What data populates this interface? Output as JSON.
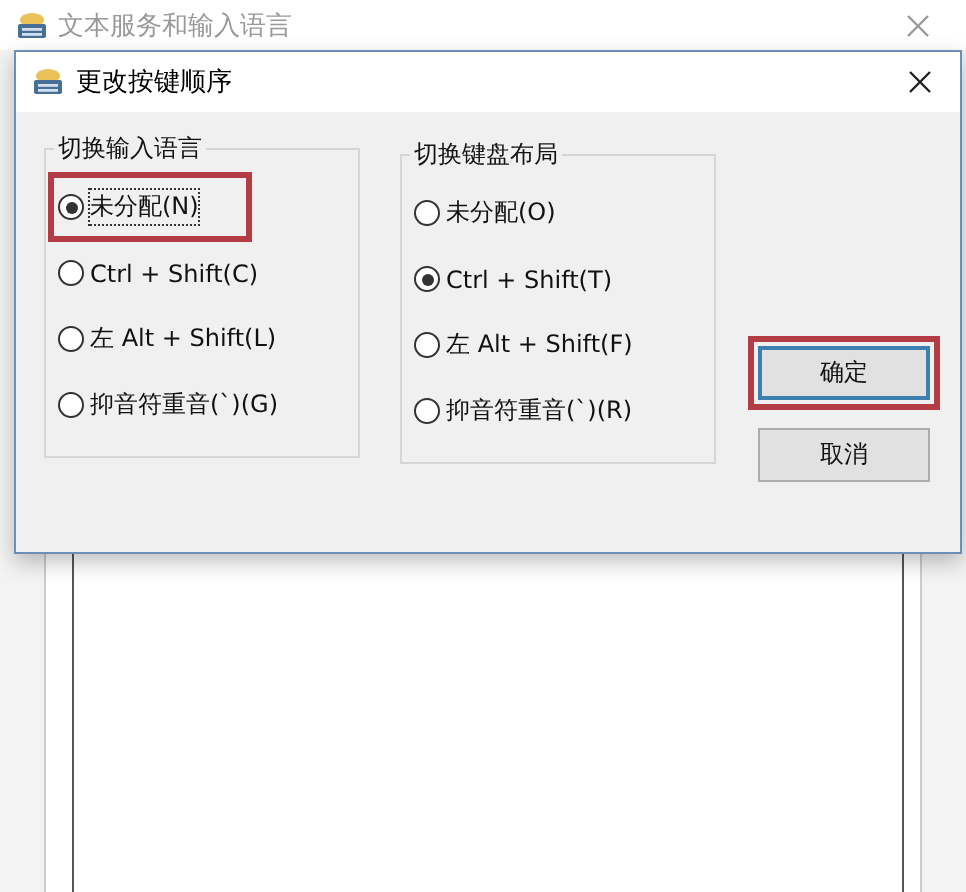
{
  "back_window": {
    "title": "文本服务和输入语言"
  },
  "dialog": {
    "title": "更改按键顺序",
    "groups": [
      {
        "title": "切换输入语言",
        "options": [
          {
            "label": "未分配(N)",
            "selected": true,
            "focused": true,
            "highlighted": true
          },
          {
            "label": "Ctrl + Shift(C)",
            "selected": false,
            "focused": false,
            "highlighted": false
          },
          {
            "label": "左 Alt + Shift(L)",
            "selected": false,
            "focused": false,
            "highlighted": false
          },
          {
            "label": "抑音符重音(`)(G)",
            "selected": false,
            "focused": false,
            "highlighted": false
          }
        ]
      },
      {
        "title": "切换键盘布局",
        "options": [
          {
            "label": "未分配(O)",
            "selected": false,
            "focused": false,
            "highlighted": false
          },
          {
            "label": "Ctrl + Shift(T)",
            "selected": true,
            "focused": false,
            "highlighted": false
          },
          {
            "label": "左 Alt + Shift(F)",
            "selected": false,
            "focused": false,
            "highlighted": false
          },
          {
            "label": "抑音符重音(`)(R)",
            "selected": false,
            "focused": false,
            "highlighted": false
          }
        ]
      }
    ],
    "buttons": [
      {
        "label": "确定",
        "default": true,
        "highlighted": true
      },
      {
        "label": "取消",
        "default": false,
        "highlighted": false
      }
    ]
  }
}
